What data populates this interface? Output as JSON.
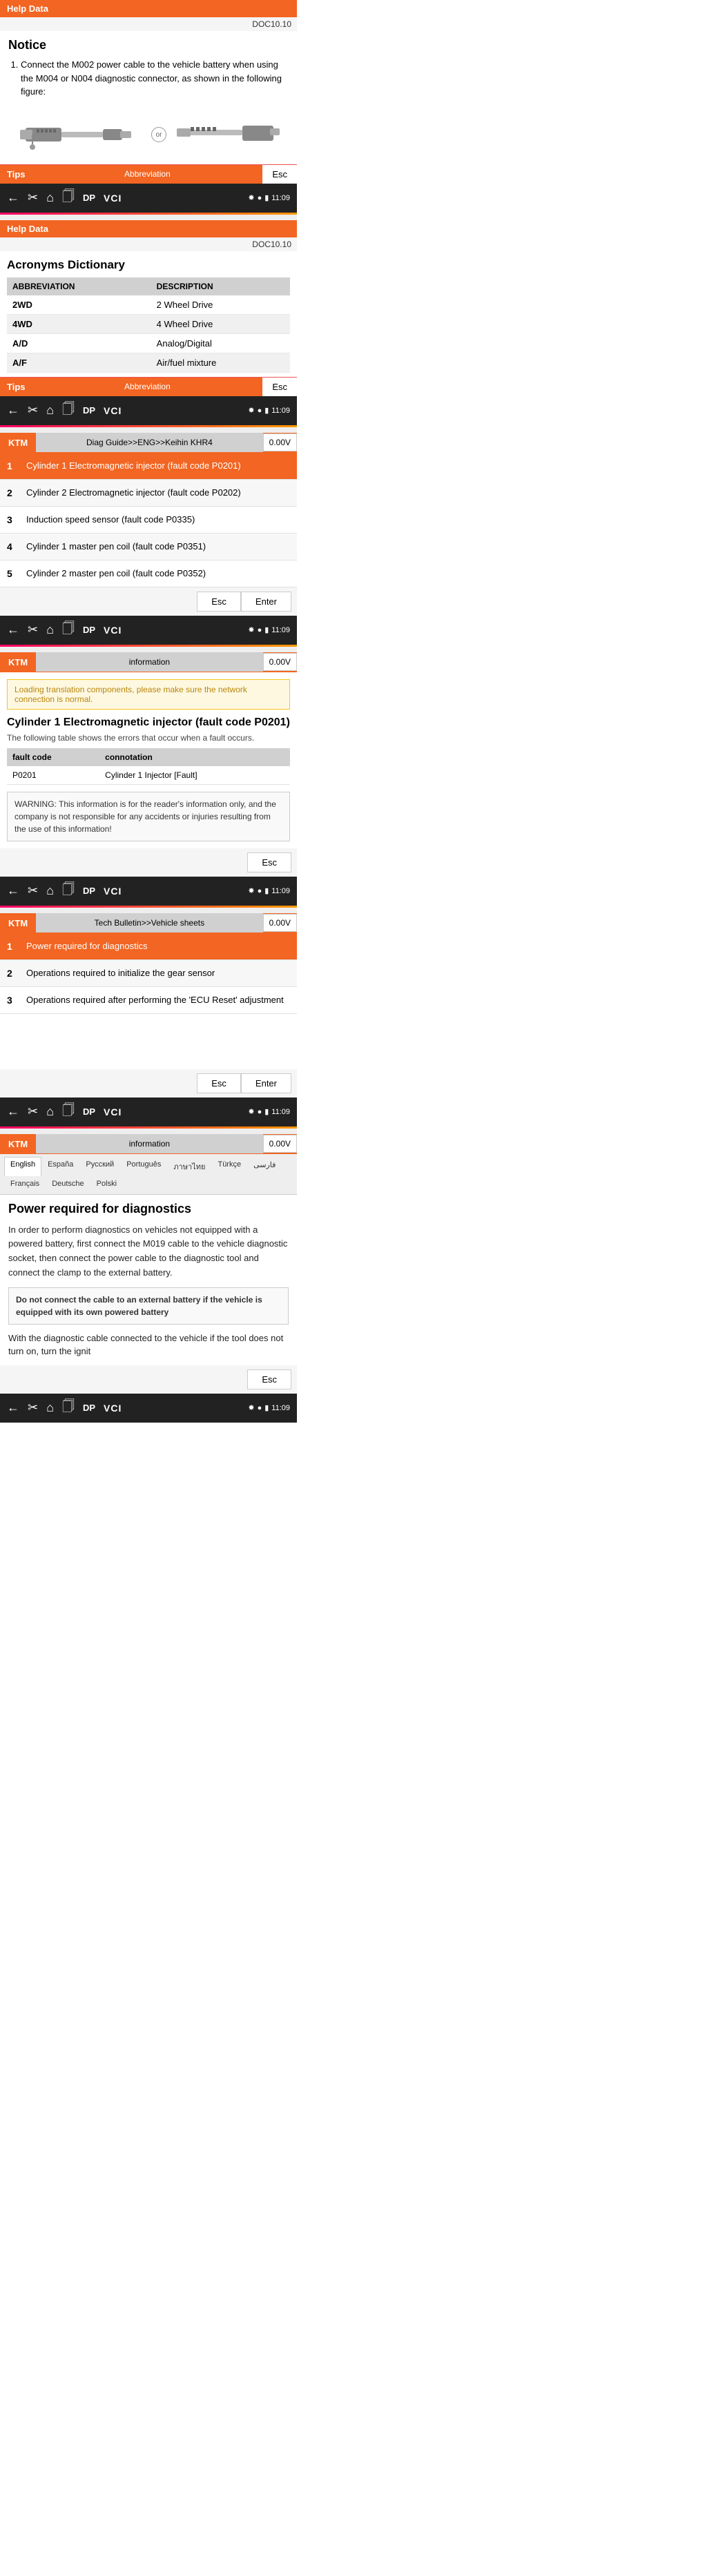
{
  "sections": {
    "section1": {
      "header": "Help Data",
      "doc_number": "DOC10.10",
      "notice_title": "Notice",
      "notice_item": "Connect the M002 power cable to the vehicle battery when using the M004 or N004 diagnostic connector, as shown in the following figure:",
      "tips_label": "Tips",
      "tips_abbr": "Abbreviation",
      "esc_label": "Esc",
      "toolbar": {
        "time": "11:09",
        "dp": "DP",
        "vci": "VCI"
      }
    },
    "section2": {
      "header": "Help Data",
      "doc_number": "DOC10.10",
      "title": "Acronyms Dictionary",
      "table_headers": [
        "ABBREVIATION",
        "DESCRIPTION"
      ],
      "rows": [
        {
          "abbr": "2WD",
          "desc": "2 Wheel Drive"
        },
        {
          "abbr": "4WD",
          "desc": "4 Wheel Drive"
        },
        {
          "abbr": "A/D",
          "desc": "Analog/Digital"
        },
        {
          "abbr": "A/F",
          "desc": "Air/fuel mixture"
        }
      ],
      "tips_label": "Tips",
      "tips_abbr": "Abbreviation",
      "esc_label": "Esc",
      "toolbar": {
        "time": "11:09",
        "dp": "DP",
        "vci": "VCI"
      }
    },
    "section3": {
      "ktm_label": "KTM",
      "breadcrumb": "Diag Guide>>ENG>>Keihin KHR4",
      "voltage": "0.00V",
      "items": [
        {
          "num": "1",
          "text": "Cylinder 1 Electromagnetic injector (fault code P0201)",
          "active": true
        },
        {
          "num": "2",
          "text": "Cylinder 2 Electromagnetic injector (fault code P0202)",
          "active": false
        },
        {
          "num": "3",
          "text": "Induction speed sensor (fault code P0335)",
          "active": false
        },
        {
          "num": "4",
          "text": "Cylinder 1 master pen coil (fault code P0351)",
          "active": false
        },
        {
          "num": "5",
          "text": "Cylinder 2 master pen coil (fault code P0352)",
          "active": false
        }
      ],
      "esc_label": "Esc",
      "enter_label": "Enter",
      "toolbar": {
        "time": "11:09",
        "dp": "DP",
        "vci": "VCI"
      }
    },
    "section4": {
      "ktm_label": "KTM",
      "breadcrumb": "information",
      "voltage": "0.00V",
      "warning_text": "Loading translation components, please make sure the network connection is normal.",
      "main_title": "Cylinder 1 Electromagnetic injector (fault code P0201)",
      "subtitle": "The following table shows the errors that occur when a fault occurs.",
      "table_headers": [
        "fault code",
        "connotation"
      ],
      "rows": [
        {
          "code": "P0201",
          "connotation": "Cylinder 1 Injector [Fault]"
        }
      ],
      "warning_box": "WARNING: This information is for the reader's information only, and the company is not responsible for any accidents or injuries resulting from the use of this information!",
      "esc_label": "Esc",
      "toolbar": {
        "time": "11:09",
        "dp": "DP",
        "vci": "VCI"
      }
    },
    "section5": {
      "ktm_label": "KTM",
      "breadcrumb": "Tech Bulletin>>Vehicle sheets",
      "voltage": "0.00V",
      "items": [
        {
          "num": "1",
          "text": "Power required for diagnostics",
          "active": true
        },
        {
          "num": "2",
          "text": "Operations required to initialize the gear sensor",
          "active": false
        },
        {
          "num": "3",
          "text": "Operations required after performing the 'ECU Reset' adjustment",
          "active": false
        }
      ],
      "esc_label": "Esc",
      "enter_label": "Enter",
      "toolbar": {
        "time": "11:09",
        "dp": "DP",
        "vci": "VCI"
      }
    },
    "section6": {
      "ktm_label": "KTM",
      "breadcrumb": "information",
      "voltage": "0.00V",
      "languages": [
        "English",
        "España",
        "Русский",
        "Português",
        "ภาษาไทย",
        "Türkçe",
        "فارسی",
        "Français",
        "Deutsche",
        "Polski"
      ],
      "active_lang": "English",
      "power_title": "Power required for diagnostics",
      "power_body": "In order to perform diagnostics on vehicles not equipped with a powered battery, first connect the M019 cable to the vehicle diagnostic socket, then connect the power cable to the diagnostic tool and connect the clamp to the external battery.",
      "power_note": "Do not connect the cable to an external battery if the vehicle is equipped with its own powered battery",
      "power_extra": "With the diagnostic cable connected to the vehicle if the tool does not turn on, turn the ignit",
      "esc_label": "Esc",
      "toolbar": {
        "time": "11:09",
        "dp": "DP",
        "vci": "VCI"
      }
    }
  }
}
